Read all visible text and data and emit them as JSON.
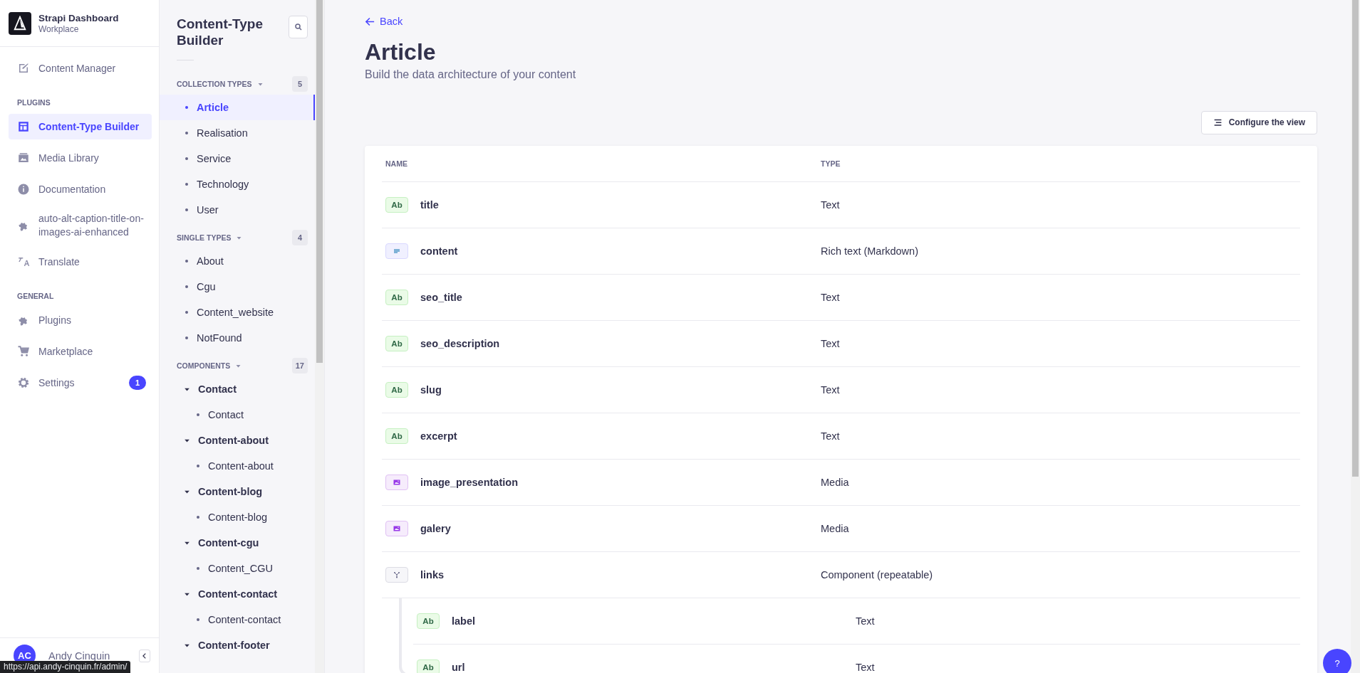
{
  "app": {
    "name": "Strapi Dashboard",
    "workspace": "Workplace"
  },
  "main_nav": [
    {
      "kind": "pen",
      "label": "Content Manager",
      "selected": false
    },
    {
      "kind": "section",
      "label": "PLUGINS"
    },
    {
      "kind": "layout",
      "label": "Content-Type Builder",
      "selected": true
    },
    {
      "kind": "image",
      "label": "Media Library",
      "selected": false
    },
    {
      "kind": "info",
      "label": "Documentation",
      "selected": false
    },
    {
      "kind": "puzzle",
      "label": "auto-alt-caption-title-on-images-ai-enhanced",
      "selected": false
    },
    {
      "kind": "translate",
      "label": "Translate",
      "selected": false
    },
    {
      "kind": "section",
      "label": "GENERAL"
    },
    {
      "kind": "puzzle",
      "label": "Plugins",
      "selected": false
    },
    {
      "kind": "cart",
      "label": "Marketplace",
      "selected": false
    },
    {
      "kind": "gear",
      "label": "Settings",
      "selected": false,
      "badge": "1"
    }
  ],
  "user": {
    "initials": "AC",
    "name": "Andy Cinquin"
  },
  "builder": {
    "title": "Content-Type Builder",
    "groups": [
      {
        "label": "COLLECTION TYPES",
        "count": "5",
        "items": [
          {
            "label": "Article",
            "selected": true
          },
          {
            "label": "Realisation",
            "selected": false
          },
          {
            "label": "Service",
            "selected": false
          },
          {
            "label": "Technology",
            "selected": false
          },
          {
            "label": "User",
            "selected": false
          }
        ]
      },
      {
        "label": "SINGLE TYPES",
        "count": "4",
        "items": [
          {
            "label": "About",
            "selected": false
          },
          {
            "label": "Cgu",
            "selected": false
          },
          {
            "label": "Content_website",
            "selected": false
          },
          {
            "label": "NotFound",
            "selected": false
          }
        ]
      },
      {
        "label": "COMPONENTS",
        "count": "17",
        "items": [
          {
            "label": "Contact",
            "expanded": true,
            "children": [
              {
                "label": "Contact",
                "selected": false
              }
            ]
          },
          {
            "label": "Content-about",
            "expanded": true,
            "children": [
              {
                "label": "Content-about",
                "selected": false
              }
            ]
          },
          {
            "label": "Content-blog",
            "expanded": true,
            "children": [
              {
                "label": "Content-blog",
                "selected": false
              }
            ]
          },
          {
            "label": "Content-cgu",
            "expanded": true,
            "children": [
              {
                "label": "Content_CGU",
                "selected": false
              }
            ]
          },
          {
            "label": "Content-contact",
            "expanded": true,
            "children": [
              {
                "label": "Content-contact",
                "selected": false
              }
            ]
          },
          {
            "label": "Content-footer",
            "expanded": true
          }
        ]
      }
    ]
  },
  "header": {
    "back": "Back",
    "title": "Article",
    "subtitle": "Build the data architecture of your content"
  },
  "configure_button": "Configure the view",
  "table": {
    "columns": [
      "NAME",
      "TYPE"
    ],
    "rows": [
      {
        "kind": "text",
        "badge": "Ab",
        "name": "title",
        "type": "Text"
      },
      {
        "kind": "richtext",
        "name": "content",
        "type": "Rich text (Markdown)"
      },
      {
        "kind": "text",
        "badge": "Ab",
        "name": "seo_title",
        "type": "Text"
      },
      {
        "kind": "text",
        "badge": "Ab",
        "name": "seo_description",
        "type": "Text"
      },
      {
        "kind": "text",
        "badge": "Ab",
        "name": "slug",
        "type": "Text"
      },
      {
        "kind": "text",
        "badge": "Ab",
        "name": "excerpt",
        "type": "Text"
      },
      {
        "kind": "media",
        "name": "image_presentation",
        "type": "Media"
      },
      {
        "kind": "media",
        "name": "galery",
        "type": "Media"
      },
      {
        "kind": "component",
        "name": "links",
        "type": "Component (repeatable)",
        "children": [
          {
            "kind": "text",
            "badge": "Ab",
            "name": "label",
            "type": "Text"
          },
          {
            "kind": "text",
            "badge": "Ab",
            "name": "url",
            "type": "Text"
          }
        ]
      }
    ]
  },
  "help_button": "?",
  "status_url": "https://api.andy-cinquin.fr/admin/"
}
